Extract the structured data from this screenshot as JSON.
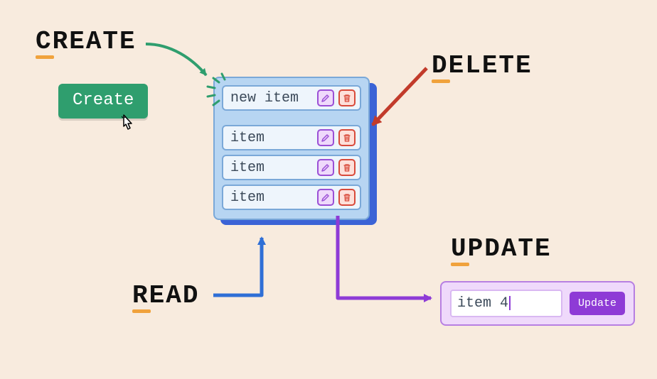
{
  "labels": {
    "create": "REATE",
    "create_first": "C",
    "read": "EAD",
    "read_first": "R",
    "update": "PDATE",
    "update_first": "U",
    "delete": "ELETE",
    "delete_first": "D"
  },
  "create_button": {
    "label": "Create"
  },
  "list": {
    "rows": [
      {
        "label": "new item"
      },
      {
        "label": "item"
      },
      {
        "label": "item"
      },
      {
        "label": "item"
      }
    ]
  },
  "update_form": {
    "input_value": "item 4",
    "button_label": "Update"
  },
  "icons": {
    "edit": "pencil-icon",
    "delete": "trash-icon",
    "cursor": "cursor-pointer-icon"
  },
  "colors": {
    "bg": "#f8ebde",
    "accent_underline": "#f0a23c",
    "green_btn": "#2f9e6e",
    "panel_bg": "#b7d5f2",
    "panel_border": "#7aa8d8",
    "panel_shadow": "#3b63d6",
    "row_bg": "#eef5fc",
    "edit_border": "#9b4fd6",
    "edit_bg": "#efd9fb",
    "del_border": "#d94a3a",
    "del_bg": "#fde0da",
    "update_bg": "#efd9fb",
    "update_border": "#b77fe2",
    "update_btn": "#8e3bd6",
    "arrow_green": "#2f9e6e",
    "arrow_blue": "#2f6fd6",
    "arrow_purple": "#8e3bd6",
    "arrow_red": "#c23b2b"
  }
}
